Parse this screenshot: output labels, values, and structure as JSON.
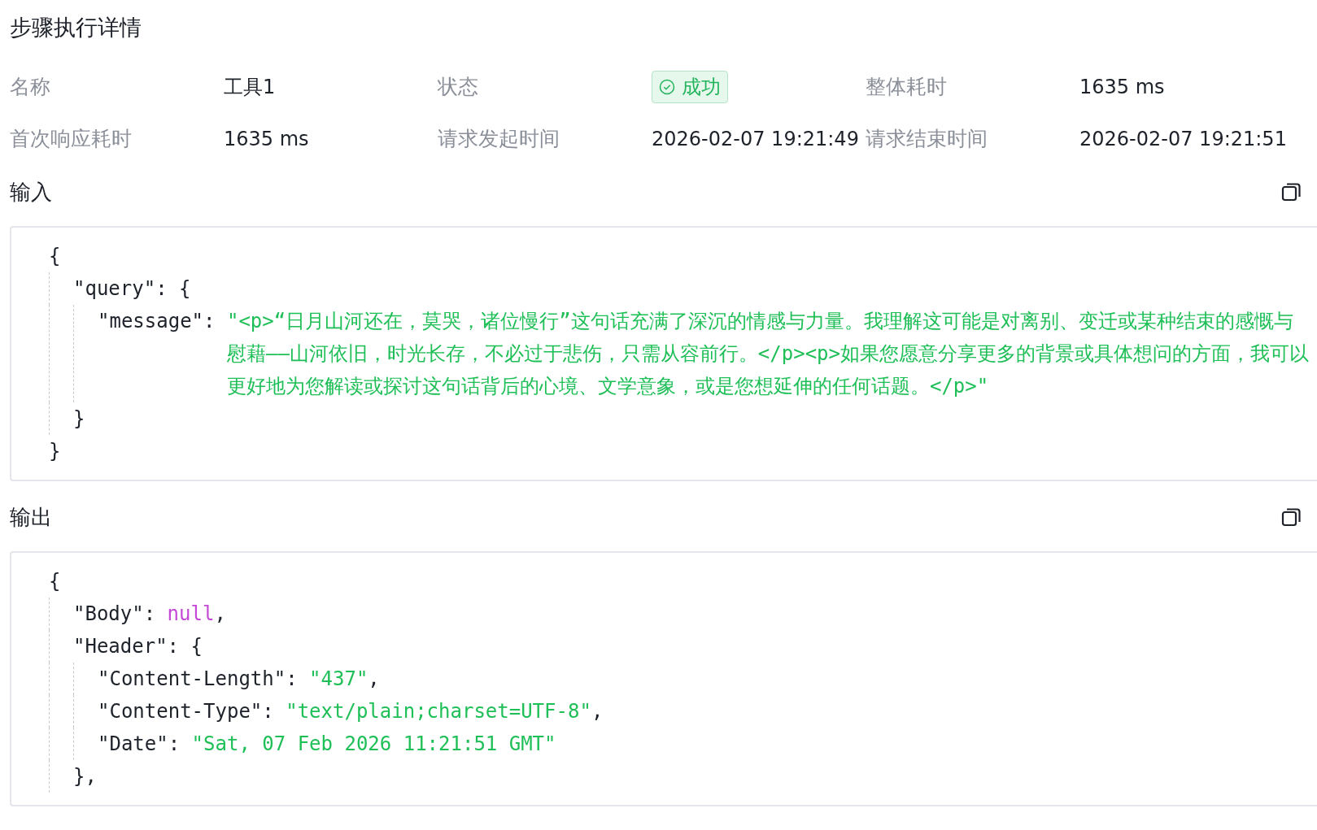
{
  "title": "步骤执行详情",
  "details": [
    {
      "label": "名称",
      "value": "工具1",
      "kind": "text"
    },
    {
      "label": "状态",
      "value": "成功",
      "kind": "status"
    },
    {
      "label": "整体耗时",
      "value": "1635 ms",
      "kind": "text"
    },
    {
      "label": "首次响应耗时",
      "value": "1635 ms",
      "kind": "text"
    },
    {
      "label": "请求发起时间",
      "value": "2026-02-07 19:21:49",
      "kind": "text"
    },
    {
      "label": "请求结束时间",
      "value": "2026-02-07 19:21:51",
      "kind": "text"
    }
  ],
  "sections": [
    {
      "title": "输入",
      "code": {
        "open": "{",
        "close": "}",
        "children": [
          {
            "kind": "object",
            "key": "\"query\": ",
            "open": "{",
            "close": "}",
            "children": [
              {
                "kind": "string",
                "key": "\"message\": ",
                "value": "\"<p>“日月山河还在，莫哭，诸位慢行”这句话充满了深沉的情感与力量。我理解这可能是对离别、变迁或某种结束的感慨与慰藉——山河依旧，时光长存，不必过于悲伤，只需从容前行。</p><p>如果您愿意分享更多的背景或具体想问的方面，我可以更好地为您解读或探讨这句话背后的心境、文学意象，或是您想延伸的任何话题。</p>\""
              }
            ]
          }
        ]
      }
    },
    {
      "title": "输出",
      "code": {
        "open": "{",
        "children": [
          {
            "kind": "null",
            "key": "\"Body\": ",
            "value": "null",
            "tail": ","
          },
          {
            "kind": "object",
            "key": "\"Header\": ",
            "open": "{",
            "close": "},",
            "children": [
              {
                "kind": "string",
                "key": "\"Content-Length\": ",
                "value": "\"437\"",
                "tail": ","
              },
              {
                "kind": "string",
                "key": "\"Content-Type\": ",
                "value": "\"text/plain;charset=UTF-8\"",
                "tail": ","
              },
              {
                "kind": "string",
                "key": "\"Date\": ",
                "value": "\"Sat, 07 Feb 2026 11:21:51 GMT\""
              }
            ]
          }
        ]
      }
    }
  ]
}
